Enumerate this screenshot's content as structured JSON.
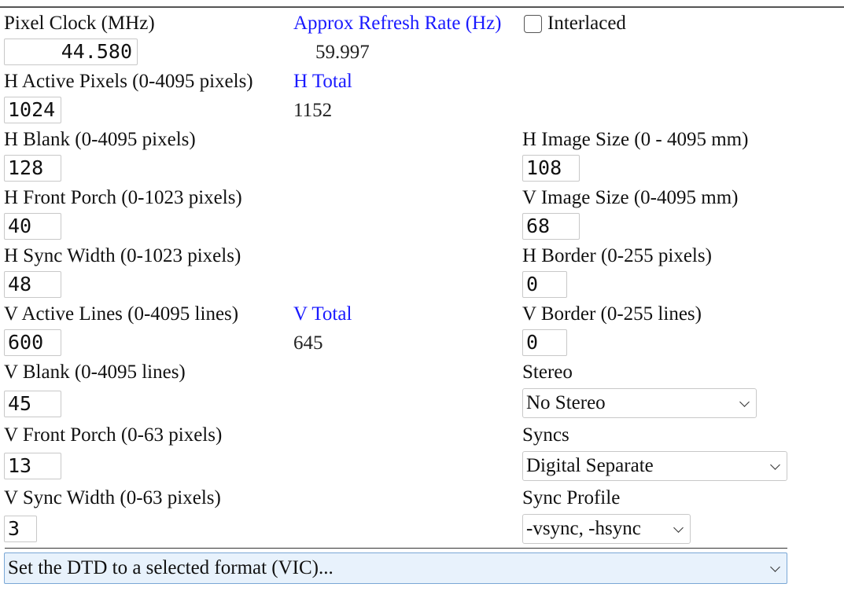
{
  "fields": {
    "pixel_clock": {
      "label": "Pixel Clock (MHz)",
      "value": "44.580"
    },
    "refresh": {
      "label": "Approx Refresh Rate (Hz)",
      "value": "59.997"
    },
    "interlaced": {
      "label": "Interlaced",
      "checked": false
    },
    "h_active": {
      "label": "H Active Pixels (0-4095 pixels)",
      "value": "1024"
    },
    "h_total": {
      "label": "H Total",
      "value": "1152"
    },
    "h_blank": {
      "label": "H Blank (0-4095 pixels)",
      "value": "128"
    },
    "h_image_size": {
      "label": "H Image Size (0 - 4095 mm)",
      "value": "108"
    },
    "h_front_porch": {
      "label": "H Front Porch (0-1023 pixels)",
      "value": "40"
    },
    "v_image_size": {
      "label": "V Image Size (0-4095 mm)",
      "value": "68"
    },
    "h_sync_width": {
      "label": "H Sync Width (0-1023 pixels)",
      "value": "48"
    },
    "h_border": {
      "label": "H Border (0-255 pixels)",
      "value": "0"
    },
    "v_active": {
      "label": "V Active Lines (0-4095 lines)",
      "value": "600"
    },
    "v_total": {
      "label": "V Total",
      "value": "645"
    },
    "v_border": {
      "label": "V Border (0-255 lines)",
      "value": "0"
    },
    "v_blank": {
      "label": "V Blank (0-4095 lines)",
      "value": "45"
    },
    "stereo": {
      "label": "Stereo",
      "value": "No Stereo"
    },
    "v_front_porch": {
      "label": "V Front Porch (0-63 pixels)",
      "value": "13"
    },
    "syncs": {
      "label": "Syncs",
      "value": "Digital Separate"
    },
    "v_sync_width": {
      "label": "V Sync Width (0-63 pixels)",
      "value": "3"
    },
    "sync_profile": {
      "label": "Sync Profile",
      "value": "-vsync, -hsync"
    }
  },
  "vic_select": {
    "value": "Set the DTD to a selected format (VIC)..."
  },
  "colors": {
    "link_blue": "#1a1aff",
    "select_highlight": "#e8f2fc",
    "select_border": "#7aa7d6"
  }
}
